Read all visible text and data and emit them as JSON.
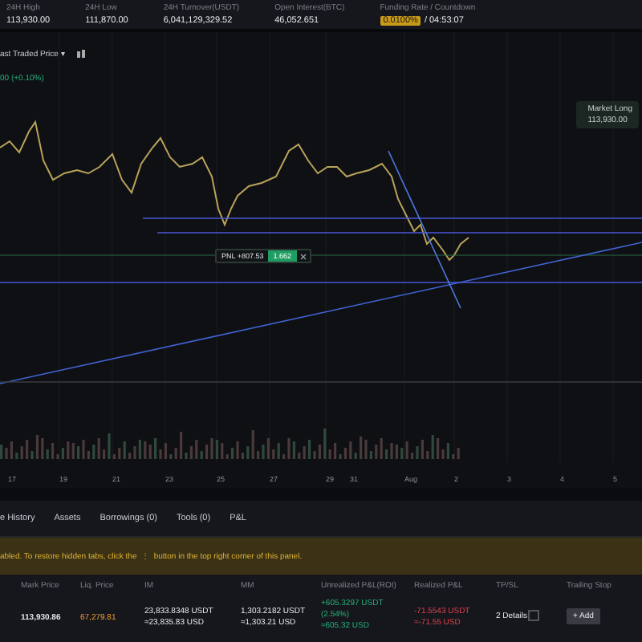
{
  "stats": [
    {
      "label": "24H High",
      "value": "113,930.00"
    },
    {
      "label": "24H Low",
      "value": "111,870.00"
    },
    {
      "label": "24H Turnover(USDT)",
      "value": "6,041,129,329.52"
    },
    {
      "label": "Open Interest(BTC)",
      "value": "46,052.651"
    },
    {
      "label": "Funding Rate / Countdown",
      "value": "0.0100%",
      "extra": "/ 04:53:07"
    }
  ],
  "chart": {
    "price_type": "ast Traded Price",
    "caret": "▾",
    "legend": "00 (+0.10%)",
    "market_long": {
      "label": "Market Long",
      "value": "113,930.00"
    },
    "pnl": {
      "label": "PNL +807.53",
      "qty": "1.662"
    },
    "x_axis": [
      "17",
      "19",
      "21",
      "23",
      "25",
      "27",
      "29",
      "31",
      "Aug",
      "2",
      "3",
      "4",
      "5"
    ]
  },
  "tabs": [
    {
      "label": "e History",
      "selected": false
    },
    {
      "label": "Assets",
      "selected": false
    },
    {
      "label": "Borrowings (0)",
      "selected": false
    },
    {
      "label": "Tools (0)",
      "selected": false
    },
    {
      "label": "P&L",
      "selected": false
    }
  ],
  "banner": {
    "before": "abled. To restore hidden tabs, click the",
    "icon": "⋮",
    "after": "button in the top right corner of this panel."
  },
  "table": {
    "columns": [
      "Mark Price",
      "Liq. Price",
      "IM",
      "MM",
      "Unrealized P&L(ROI)",
      "Realized P&L",
      "TP/SL",
      "Trailing Stop"
    ],
    "row": {
      "mark_price": "113,930.86",
      "liq_price": "67,279.81",
      "im": [
        "23,833.8348 USDT",
        "≈23,835.83 USD"
      ],
      "mm": [
        "1,303.2182 USDT",
        "≈1,303.21 USD"
      ],
      "unrealized": [
        "+605.3297 USDT",
        "(2.54%)",
        "≈605.32 USD"
      ],
      "realized": [
        "-71.5543 USDT",
        "≈-71.55 USD"
      ],
      "tpsl": "2 Details",
      "trailing": "+ Add"
    }
  }
}
